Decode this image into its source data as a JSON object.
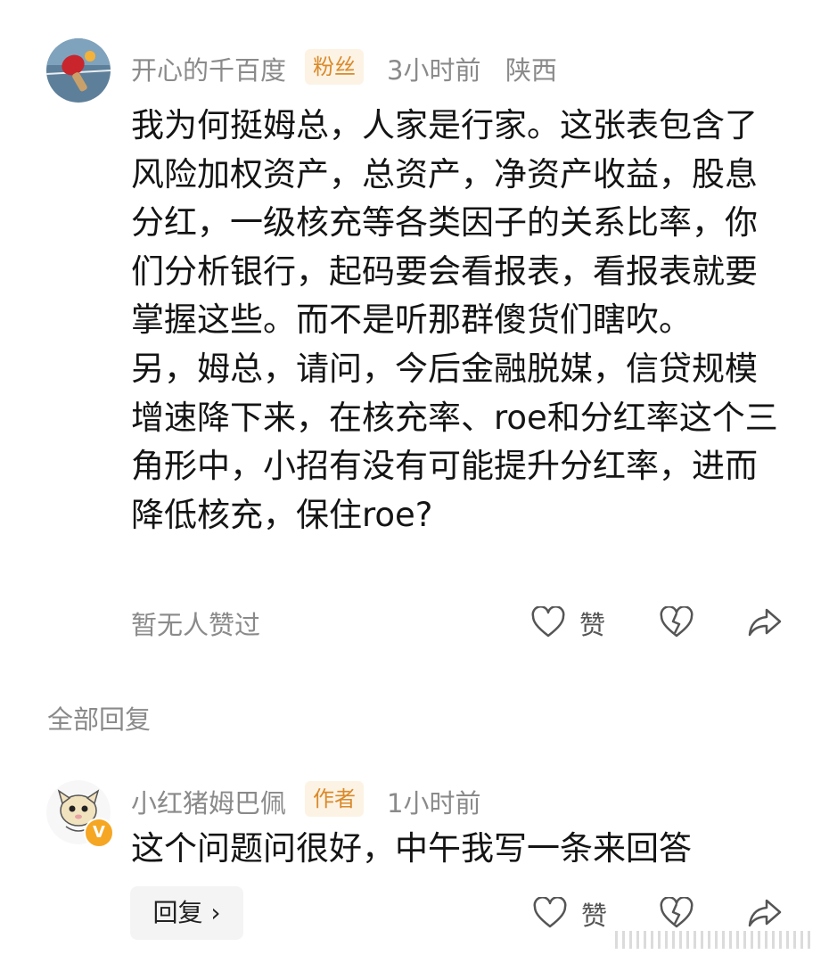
{
  "comment": {
    "username": "开心的千百度",
    "badge": "粉丝",
    "time": "3小时前",
    "location": "陕西",
    "paragraphs": [
      "我为何挺姆总，人家是行家。这张表包含了风险加权资产，总资产，净资产收益，股息分红，一级核充等各类因子的关系比率，你们分析银行，起码要会看报表，看报表就要掌握这些。而不是听那群傻货们瞎吹。",
      "另，姆总，请问，今后金融脱媒，信贷规模增速降下来，在核充率、roe和分红率这个三角形中，小招有没有可能提升分红率，进而降低核充，保住roe?"
    ],
    "likes_status": "暂无人赞过",
    "like_label": "赞"
  },
  "section_label": "全部回复",
  "reply": {
    "username": "小红猪姆巴佩",
    "badge": "作者",
    "time": "1小时前",
    "verified_mark": "V",
    "text": "这个问题问很好，中午我写一条来回答",
    "reply_button": "回复 ›",
    "like_label": "赞"
  },
  "colors": {
    "badge_bg": "#fdf3e4",
    "badge_text": "#d98a2b",
    "meta_gray": "#8a8a8a",
    "verified": "#f5a623"
  }
}
